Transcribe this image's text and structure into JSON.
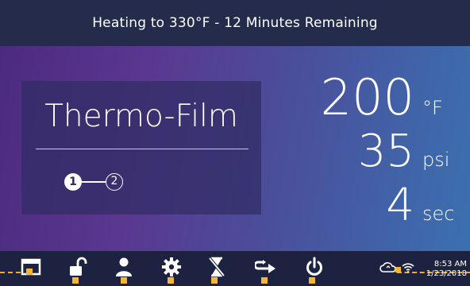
{
  "status_bar": {
    "message": "Heating to 330°F - 12 Minutes Remaining"
  },
  "program": {
    "name": "Thermo-Film",
    "steps": [
      "1",
      "2"
    ],
    "active_step": 1
  },
  "readouts": {
    "temperature": {
      "value": "200",
      "unit": "°F"
    },
    "pressure": {
      "value": "35",
      "unit": "psi"
    },
    "time": {
      "value": "4",
      "unit": "sec"
    }
  },
  "nav": {
    "buttons": [
      {
        "name": "home-button",
        "icon": "window-icon"
      },
      {
        "name": "lock-button",
        "icon": "unlock-icon"
      },
      {
        "name": "user-button",
        "icon": "user-icon"
      },
      {
        "name": "settings-button",
        "icon": "gear-icon"
      },
      {
        "name": "timer-disable-button",
        "icon": "hourglass-off-icon"
      },
      {
        "name": "cycle-button",
        "icon": "cycle-arrow-icon"
      },
      {
        "name": "power-button",
        "icon": "power-icon"
      }
    ]
  },
  "system_status": {
    "time": "8:53 AM",
    "date": "1/23/2018",
    "icons": [
      "cloud-sync-icon",
      "wifi-icon"
    ]
  },
  "colors": {
    "accent_marker": "#f5b731",
    "top_bar": "#252b4a",
    "bottom_bar": "#1d2240"
  }
}
